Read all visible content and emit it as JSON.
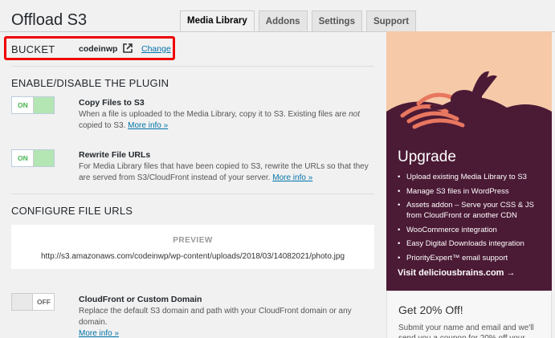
{
  "page_title": "Offload S3",
  "tabs": [
    {
      "label": "Media Library",
      "active": true
    },
    {
      "label": "Addons"
    },
    {
      "label": "Settings"
    },
    {
      "label": "Support"
    }
  ],
  "bucket": {
    "label": "BUCKET",
    "value": "codeinwp",
    "change_label": "Change",
    "highlight_color": "#e00000"
  },
  "enable_section": {
    "heading": "ENABLE/DISABLE THE PLUGIN",
    "options": [
      {
        "toggle": "ON",
        "title": "Copy Files to S3",
        "desc_parts": [
          "When a file is uploaded to the Media Library, copy it to S3. Existing files are ",
          "not",
          " copied to S3."
        ],
        "more": "More info »"
      },
      {
        "toggle": "ON",
        "title": "Rewrite File URLs",
        "desc": "For Media Library files that have been copied to S3, rewrite the URLs so that they are served from S3/CloudFront instead of your server.",
        "more": "More info »"
      }
    ]
  },
  "configure_section": {
    "heading": "CONFIGURE FILE URLS",
    "preview_label": "PREVIEW",
    "preview_url": "http://s3.amazonaws.com/codeinwp/wp-content/uploads/2018/03/14082021/photo.jpg",
    "option": {
      "toggle": "OFF",
      "title": "CloudFront or Custom Domain",
      "desc": "Replace the default S3 domain and path with your CloudFront domain or any domain.",
      "more": "More info »"
    }
  },
  "sidebar": {
    "upgrade_heading": "Upgrade",
    "features": [
      "Upload existing Media Library to S3",
      "Manage S3 files in WordPress",
      "Assets addon – Serve your CSS & JS from CloudFront or another CDN",
      "WooCommerce integration",
      "Easy Digital Downloads integration",
      "PriorityExpert™ email support"
    ],
    "visit_link": "Visit deliciousbrains.com →",
    "offer_heading": "Get 20% Off!",
    "offer_text": "Submit your name and email and we'll send you a coupon for 20% off your",
    "colors": {
      "hero": "#f6c9a8",
      "panel": "#4b1a35"
    }
  },
  "icons": {
    "external": "external-link-icon",
    "mascot": "rabbit-mascot-icon"
  },
  "colors": {
    "link": "#0073aa",
    "toggle_on": "#b3e6b3",
    "toggle_on_text": "#46b450"
  }
}
